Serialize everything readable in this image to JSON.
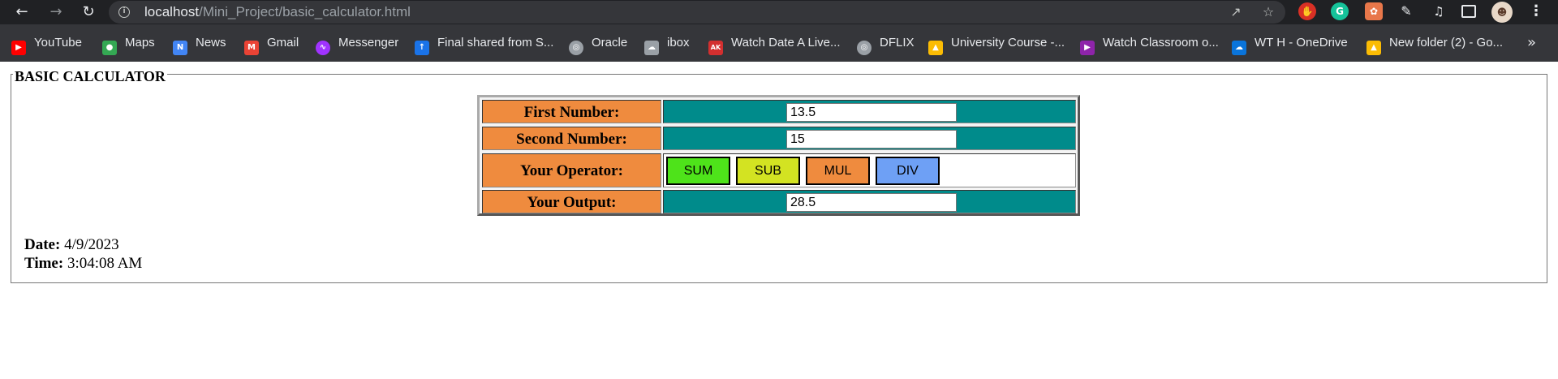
{
  "browser": {
    "url_host": "localhost",
    "url_path": "/Mini_Project/basic_calculator.html"
  },
  "bookmarks": [
    {
      "label": "YouTube",
      "icon": "youtube-icon",
      "color": "#ff0000"
    },
    {
      "label": "Maps",
      "icon": "maps-icon",
      "color": "#34a853"
    },
    {
      "label": "News",
      "icon": "news-icon",
      "color": "#4285f4"
    },
    {
      "label": "Gmail",
      "icon": "gmail-icon",
      "color": "#ea4335"
    },
    {
      "label": "Messenger",
      "icon": "messenger-icon",
      "color": "#a033ff"
    },
    {
      "label": "Final shared from S...",
      "icon": "cloud-upload-icon",
      "color": "#1a73e8"
    },
    {
      "label": "Oracle",
      "icon": "globe-icon",
      "color": "#9aa0a6"
    },
    {
      "label": "ibox",
      "icon": "ibox-icon",
      "color": "#9aa0a6"
    },
    {
      "label": "Watch Date A Live...",
      "icon": "ak-icon",
      "color": "#d32f2f"
    },
    {
      "label": "DFLIX",
      "icon": "globe-icon",
      "color": "#9aa0a6"
    },
    {
      "label": "University Course -...",
      "icon": "google-drive-icon",
      "color": "#fbbc04"
    },
    {
      "label": "Watch Classroom o...",
      "icon": "play-icon",
      "color": "#8e24aa"
    },
    {
      "label": "WT H - OneDrive",
      "icon": "onedrive-icon",
      "color": "#0a74da"
    },
    {
      "label": "New folder (2) - Go...",
      "icon": "google-drive-icon",
      "color": "#fbbc04"
    }
  ],
  "calculator": {
    "legend": "BASIC CALCULATOR",
    "first_label": "First Number:",
    "first_value": "13.5",
    "second_label": "Second Number:",
    "second_value": "15",
    "operator_label": "Your Operator:",
    "operators": {
      "sum": "SUM",
      "sub": "SUB",
      "mul": "MUL",
      "div": "DIV"
    },
    "output_label": "Your Output:",
    "output_value": "28.5"
  },
  "footer": {
    "date_label": "Date:",
    "date_value": "4/9/2023",
    "time_label": "Time:",
    "time_value": "3:04:08 AM"
  },
  "colors": {
    "label_cell": "#ef8b3e",
    "value_cell": "#008b8b",
    "sum_button": "#4ee31a",
    "sub_button": "#d3e322",
    "mul_button": "#ef8b3e",
    "div_button": "#6ea0f5"
  }
}
